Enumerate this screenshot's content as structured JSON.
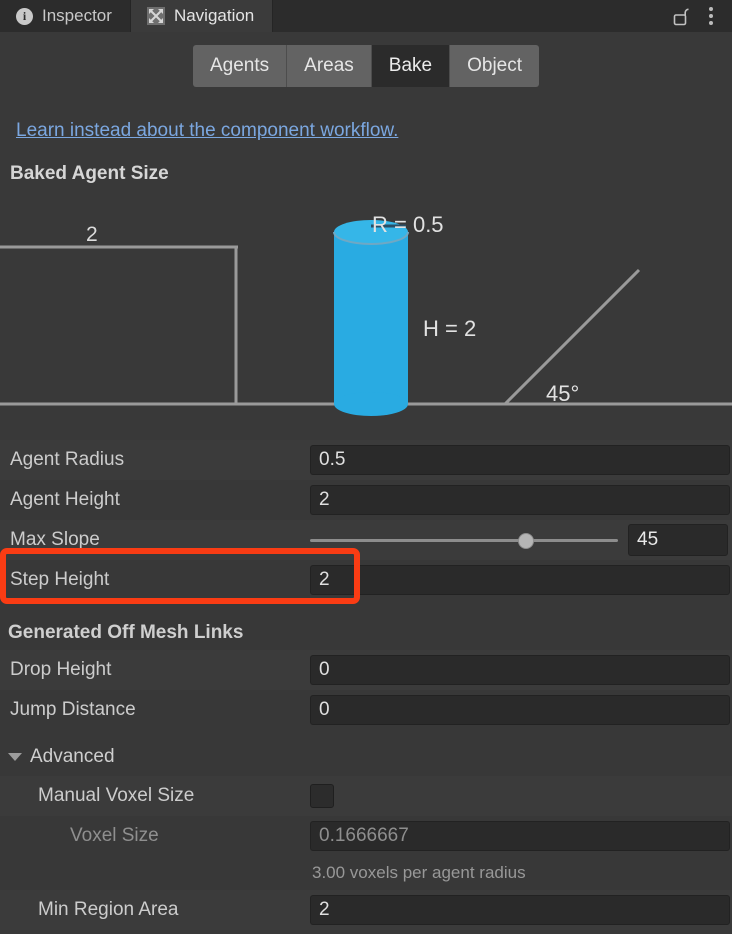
{
  "window": {
    "tabs": [
      {
        "label": "Inspector",
        "icon": "info-icon",
        "active": false
      },
      {
        "label": "Navigation",
        "icon": "navigation-icon",
        "active": true
      }
    ],
    "lock_icon": "unlocked-padlock-icon",
    "menu_icon": "kebab-menu-icon"
  },
  "toolbar": {
    "tabs": [
      {
        "label": "Agents",
        "selected": false
      },
      {
        "label": "Areas",
        "selected": false
      },
      {
        "label": "Bake",
        "selected": true
      },
      {
        "label": "Object",
        "selected": false
      }
    ]
  },
  "link": {
    "text": "Learn instead about the component workflow.",
    "color": "#7ba7e0"
  },
  "sections": {
    "baked_agent_size": "Baked Agent Size",
    "generated_off_mesh_links": "Generated Off Mesh Links",
    "advanced": "Advanced"
  },
  "diagram": {
    "step_label": "2",
    "radius_label": "R = 0.5",
    "height_label": "H = 2",
    "slope_label": "45°",
    "cylinder_color": "#29abe2",
    "cylinder_top_color": "#35b6e8",
    "line_color": "#9a9a9a"
  },
  "fields": {
    "agent_radius": {
      "label": "Agent Radius",
      "value": "0.5"
    },
    "agent_height": {
      "label": "Agent Height",
      "value": "2"
    },
    "max_slope": {
      "label": "Max Slope",
      "value": "45",
      "percent": 70
    },
    "step_height": {
      "label": "Step Height",
      "value": "2"
    },
    "drop_height": {
      "label": "Drop Height",
      "value": "0"
    },
    "jump_distance": {
      "label": "Jump Distance",
      "value": "0"
    },
    "manual_voxel_size": {
      "label": "Manual Voxel Size",
      "checked": false
    },
    "voxel_size": {
      "label": "Voxel Size",
      "value": "0.1666667"
    },
    "voxel_helper": "3.00 voxels per agent radius",
    "min_region_area": {
      "label": "Min Region Area",
      "value": "2"
    }
  },
  "annotation": {
    "highlight_color": "#fa3c14",
    "target": "step-height-row"
  }
}
